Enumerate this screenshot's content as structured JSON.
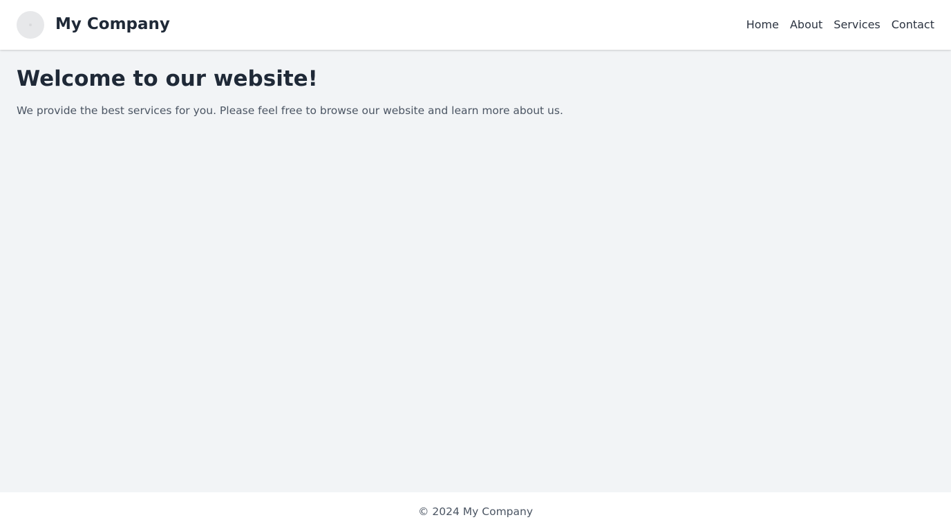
{
  "header": {
    "brand": "My Company",
    "nav": [
      {
        "label": "Home"
      },
      {
        "label": "About"
      },
      {
        "label": "Services"
      },
      {
        "label": "Contact"
      }
    ]
  },
  "main": {
    "title": "Welcome to our website!",
    "intro": "We provide the best services for you. Please feel free to browse our website and learn more about us."
  },
  "footer": {
    "text": "© 2024 My Company"
  },
  "colors": {
    "page_background": "#f2f4f6",
    "header_background": "#ffffff",
    "heading_text": "#1f2937",
    "body_text": "#4b5563"
  },
  "icons": {
    "logo": "company-logo-icon"
  }
}
